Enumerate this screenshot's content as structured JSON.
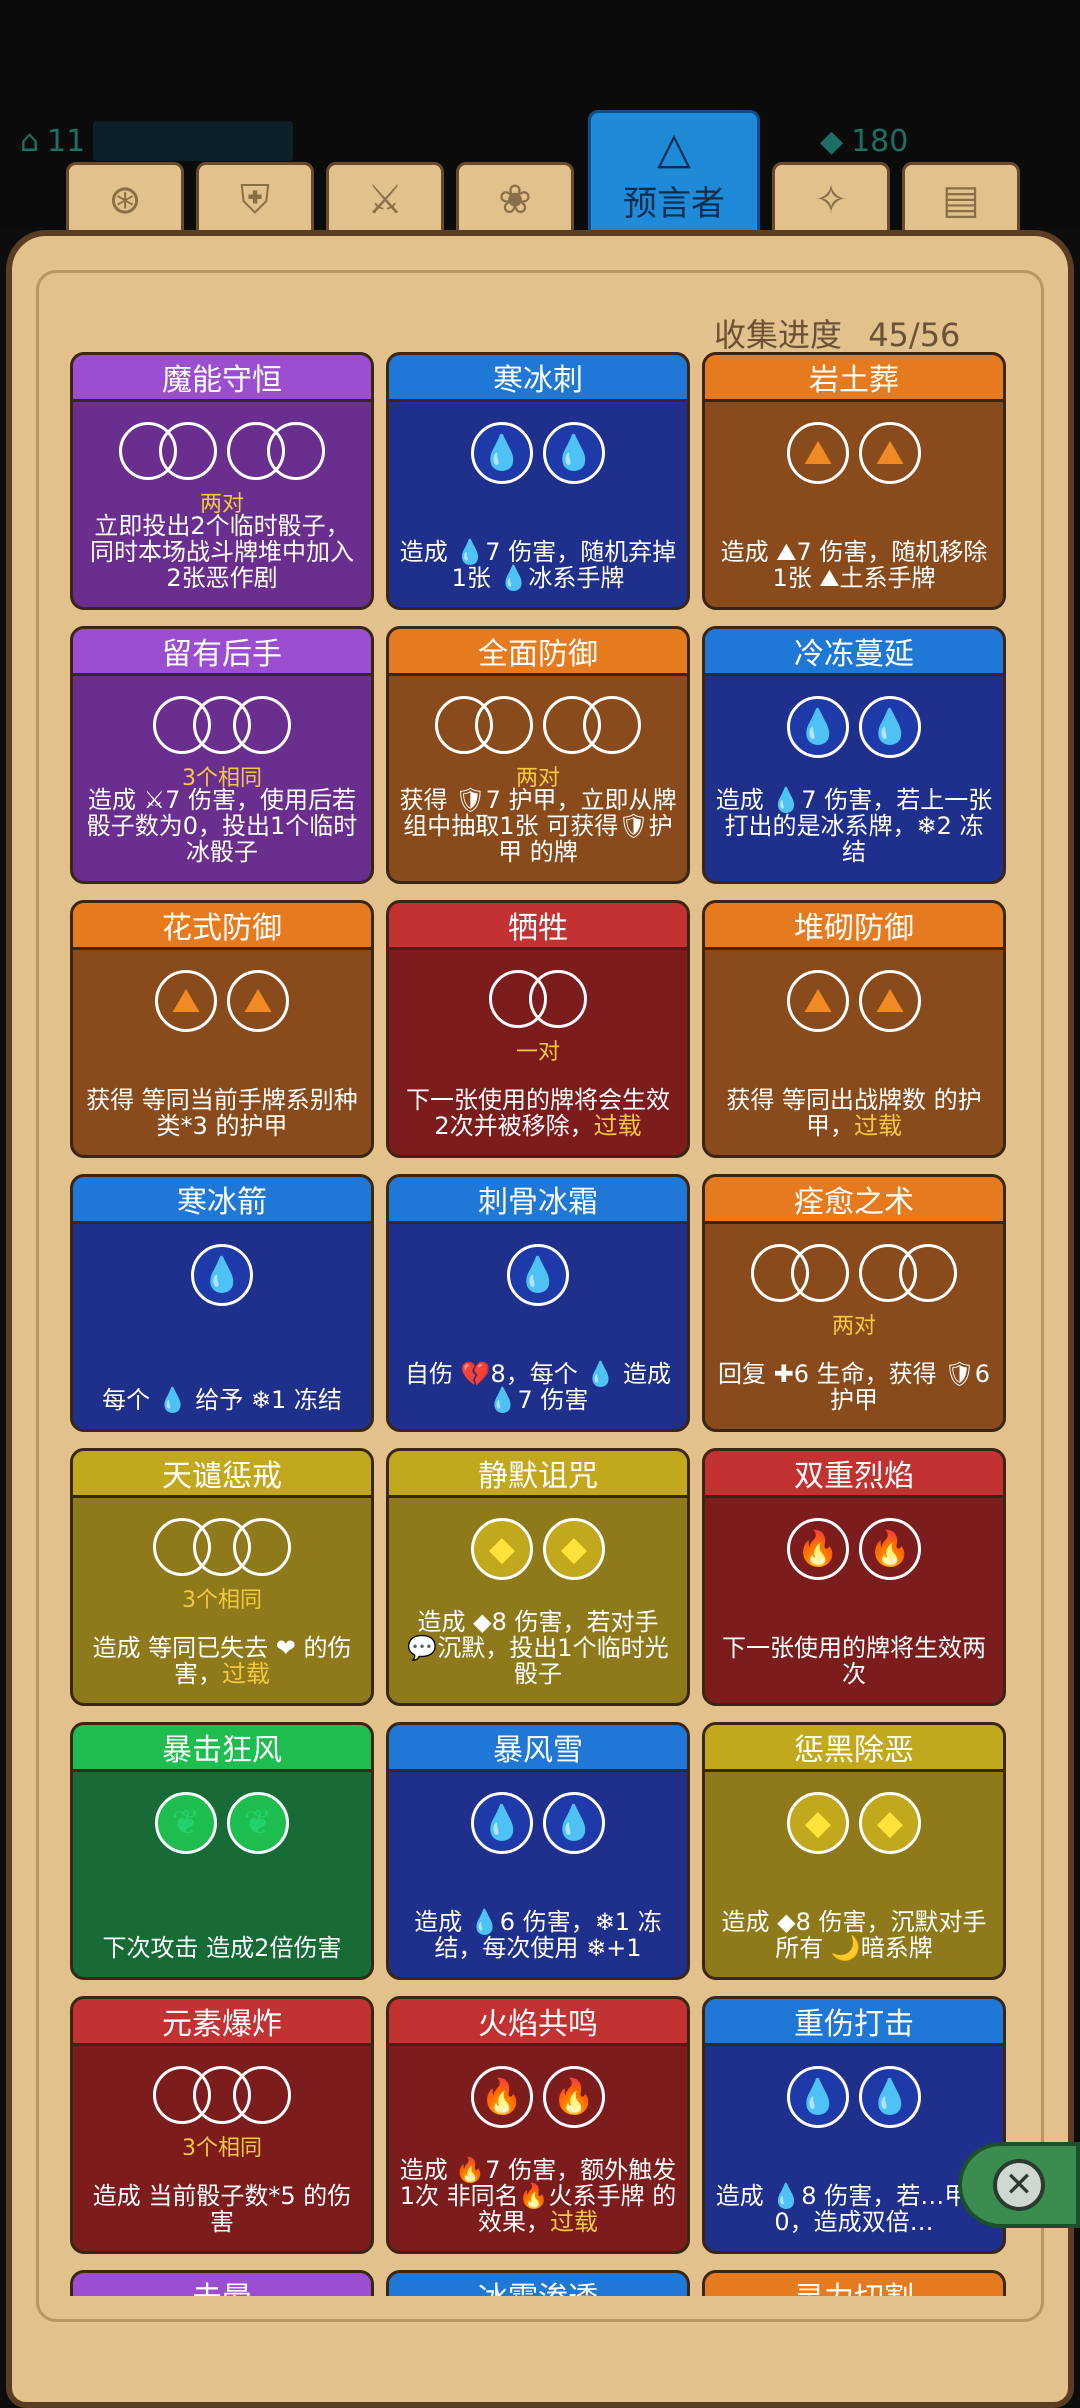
{
  "top_stats": {
    "left_value": "11",
    "right_value": "180"
  },
  "tabs": [
    {
      "icon": "⊛"
    },
    {
      "icon": "⛨"
    },
    {
      "icon": "⚔"
    },
    {
      "icon": "❀"
    },
    {
      "icon": "△",
      "label": "预言者",
      "active": true
    },
    {
      "icon": "✧"
    },
    {
      "icon": "▤"
    }
  ],
  "progress": {
    "label": "收集进度",
    "value": "45/56"
  },
  "colors": {
    "purple": "#9b4fd0",
    "navy": "#1f77d6",
    "brown": "#e67a1f",
    "maroon": "#c23232",
    "olive": "#c2a81d",
    "green": "#1ebd4f"
  },
  "cards": [
    {
      "title": "魔能守恒",
      "theme": "purple",
      "dice": "two-pairs",
      "cond": "两对",
      "desc": "立即投出2个临时骰子，同时本场战斗牌堆中加入2张恶作剧"
    },
    {
      "title": "寒冰刺",
      "theme": "navy",
      "dice": "water-water",
      "cond": "",
      "desc": "造成 💧7 伤害，随机弃掉1张 💧冰系手牌"
    },
    {
      "title": "岩土葬",
      "theme": "brown",
      "dice": "rock-rock",
      "cond": "",
      "desc": "造成 ⛰7 伤害，随机移除1张 ⛰土系手牌"
    },
    {
      "title": "留有后手",
      "theme": "purple",
      "dice": "three-same",
      "cond": "3个相同",
      "desc": "造成 ⚔7 伤害，使用后若骰子数为0，投出1个临时冰骰子"
    },
    {
      "title": "全面防御",
      "theme": "brown",
      "dice": "two-pairs",
      "cond": "两对",
      "desc": "获得 🛡7 护甲，立即从牌组中抽取1张 可获得🛡护甲 的牌"
    },
    {
      "title": "冷冻蔓延",
      "theme": "navy",
      "dice": "water-water",
      "cond": "",
      "desc": "造成 💧7 伤害，若上一张打出的是冰系牌，❄2 冻结"
    },
    {
      "title": "花式防御",
      "theme": "brown",
      "dice": "rock-rock",
      "cond": "",
      "desc": "获得 等同当前手牌系别种类*3 的护甲"
    },
    {
      "title": "牺牲",
      "theme": "maroon",
      "dice": "one-pair",
      "cond": "一对",
      "desc": "下一张使用的牌将会生效2次并被移除，",
      "extra": "过载"
    },
    {
      "title": "堆砌防御",
      "theme": "brown",
      "dice": "rock-rock",
      "cond": "",
      "desc": "获得 等同出战牌数 的护甲，",
      "extra": "过载"
    },
    {
      "title": "寒冰箭",
      "theme": "navy",
      "dice": "water",
      "cond": "",
      "desc": "每个 💧 给予 ❄1 冻结"
    },
    {
      "title": "刺骨冰霜",
      "theme": "navy",
      "dice": "water",
      "cond": "",
      "desc": "自伤 💔8，每个 💧 造成 💧7 伤害"
    },
    {
      "title": "痊愈之术",
      "theme": "brown",
      "dice": "two-pairs",
      "cond": "两对",
      "desc": "回复 ✚6 生命，获得 🛡6 护甲"
    },
    {
      "title": "天谴惩戒",
      "theme": "olive",
      "dice": "three-same",
      "cond": "3个相同",
      "desc": "造成 等同已失去 ❤ 的伤害，",
      "extra": "过载"
    },
    {
      "title": "静默诅咒",
      "theme": "olive",
      "dice": "light-light",
      "cond": "",
      "desc": "造成 ◆8 伤害，若对手 💬沉默，投出1个临时光骰子"
    },
    {
      "title": "双重烈焰",
      "theme": "maroon",
      "dice": "fire-fire",
      "cond": "",
      "desc": "下一张使用的牌将生效两次"
    },
    {
      "title": "暴击狂风",
      "theme": "green",
      "dice": "wind-wind",
      "cond": "",
      "desc": "下次攻击 造成2倍伤害"
    },
    {
      "title": "暴风雪",
      "theme": "navy",
      "dice": "water-water",
      "cond": "",
      "desc": "造成 💧6 伤害，❄1 冻结，每次使用 ❄+1"
    },
    {
      "title": "惩黑除恶",
      "theme": "olive",
      "dice": "light-light",
      "cond": "",
      "desc": "造成 ◆8 伤害，沉默对手所有 🌙暗系牌"
    },
    {
      "title": "元素爆炸",
      "theme": "maroon",
      "dice": "three-same",
      "cond": "3个相同",
      "desc": "造成 当前骰子数*5 的伤害"
    },
    {
      "title": "火焰共鸣",
      "theme": "maroon",
      "dice": "fire-fire",
      "cond": "",
      "desc": "造成 🔥7 伤害，额外触发1次 非同名🔥火系手牌 的效果，",
      "extra": "过载"
    },
    {
      "title": "重伤打击",
      "theme": "navy",
      "dice": "water-water",
      "cond": "",
      "desc": "造成 💧8 伤害，若…甲为0，造成双倍…"
    },
    {
      "title": "击晕",
      "theme": "purple",
      "dice": "",
      "cond": "",
      "desc": ""
    },
    {
      "title": "冰霜渗透",
      "theme": "navy",
      "dice": "",
      "cond": "",
      "desc": ""
    },
    {
      "title": "灵力切割",
      "theme": "brown",
      "dice": "",
      "cond": "",
      "desc": ""
    }
  ],
  "close_button": {
    "icon": "close-icon"
  }
}
